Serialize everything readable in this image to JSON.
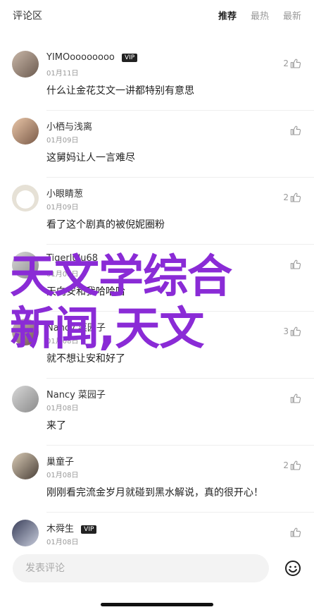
{
  "header": {
    "title": "评论区",
    "tabs": [
      {
        "label": "推荐",
        "active": true
      },
      {
        "label": "最热",
        "active": false
      },
      {
        "label": "最新",
        "active": false
      }
    ]
  },
  "comments": [
    {
      "name": "YIMOoooooooo",
      "vip": "VIP",
      "date": "01月11日",
      "text": "什么让金花艾文一讲都特别有意思",
      "likes": "2"
    },
    {
      "name": "小栖与浅离",
      "vip": "",
      "date": "01月09日",
      "text": "这舅妈让人一言难尽",
      "likes": ""
    },
    {
      "name": "小眼睛葱",
      "vip": "",
      "date": "01月09日",
      "text": "看了这个剧真的被倪妮圈粉",
      "likes": "2"
    },
    {
      "name": "Tigerlulu68",
      "vip": "",
      "date": "01月08日",
      "text": "天向安和我哈哈哈",
      "likes": ""
    },
    {
      "name": "Nancy 菜园子",
      "vip": "",
      "date": "01月08日",
      "text": "就不想让安和好了",
      "likes": "3"
    },
    {
      "name": "Nancy 菜园子",
      "vip": "",
      "date": "01月08日",
      "text": "来了",
      "likes": ""
    },
    {
      "name": "巢童子",
      "vip": "",
      "date": "01月08日",
      "text": "刚刚看完流金岁月就碰到黑水解说，真的很开心！",
      "likes": "2"
    },
    {
      "name": "木舜生",
      "vip": "VIP",
      "date": "01月08日",
      "text": "",
      "likes": ""
    }
  ],
  "overlay": {
    "line1": "天文学综合",
    "line2": "新闻,天文"
  },
  "input": {
    "placeholder": "发表评论"
  },
  "icons": {
    "like": "thumb-up-icon",
    "emoji": "smiley-icon"
  },
  "colors": {
    "overlay": "#8a2bd6"
  }
}
